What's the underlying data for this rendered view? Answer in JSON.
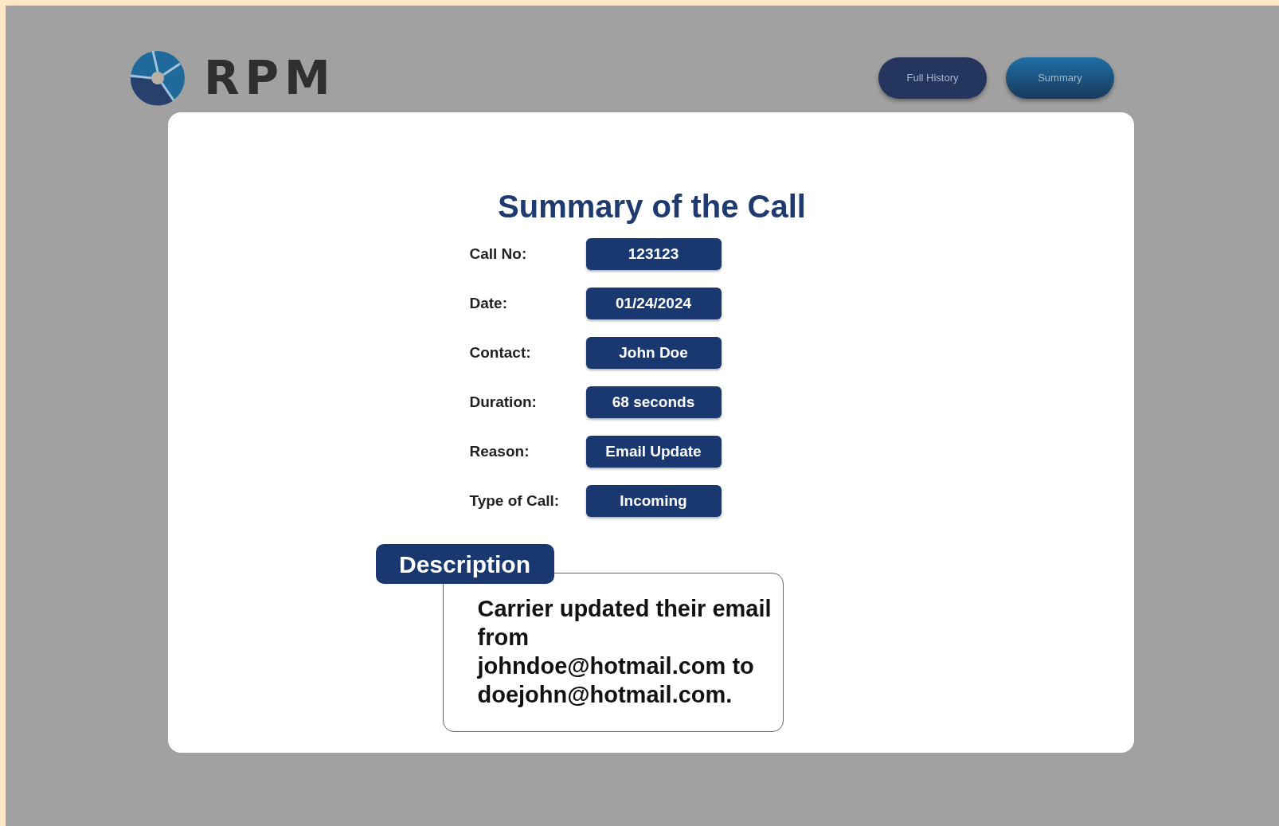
{
  "logo": {
    "text": "RPM"
  },
  "tabs": [
    {
      "label": "Full History",
      "selected": false
    },
    {
      "label": "Summary",
      "selected": true
    }
  ],
  "title": "Summary of the Call",
  "fields": [
    {
      "label": "Call No:",
      "value": "123123"
    },
    {
      "label": "Date:",
      "value": "01/24/2024"
    },
    {
      "label": "Contact:",
      "value": "John Doe"
    },
    {
      "label": "Duration:",
      "value": "68 seconds"
    },
    {
      "label": "Reason:",
      "value": "Email Update"
    },
    {
      "label": "Type of Call:",
      "value": "Incoming"
    }
  ],
  "description": {
    "heading": "Description",
    "text": "Carrier updated their email from johndoe@hotmail.com to doejohn@hotmail.com."
  }
}
